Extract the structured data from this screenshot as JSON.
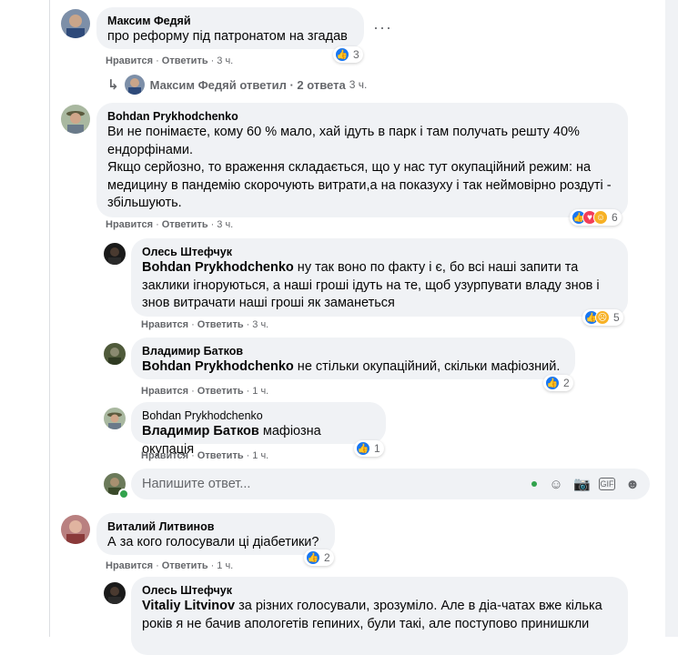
{
  "comments": [
    {
      "author": "Максим Федяй",
      "text": "про реформу під патронатом на згадав",
      "actions": {
        "like": "Нравится",
        "reply": "Ответить",
        "time": "3 ч."
      },
      "reactions": {
        "count": "3"
      },
      "replies_link": {
        "author": "Максим Федяй",
        "label": "ответил · 2 ответа",
        "time": "3 ч."
      }
    },
    {
      "author": "Bohdan Prykhodchenko",
      "text": "Ви не понімаєте, кому 60 % мало, хай ідуть в парк і там получать решту 40% ендорфінами.\nЯкщо серйозно, то враження складається, що у нас тут окупаційний режим: на медицину в пандемію скорочують витрати,а на показуху і так неймовірно роздуті - збільшують.",
      "actions": {
        "like": "Нравится",
        "reply": "Ответить",
        "time": "3 ч."
      },
      "reactions": {
        "count": "6"
      },
      "replies": [
        {
          "author": "Олесь Штефчук",
          "mention": "Bohdan Prykhodchenko",
          "text": " ну так воно по факту і є, бо всі наші запити та заклики ігноруються, а наші гроші ідуть на те, щоб узурпувати владу знов і знов витрачати наші гроші як заманеться",
          "actions": {
            "like": "Нравится",
            "reply": "Ответить",
            "time": "3 ч."
          },
          "reactions": {
            "count": "5"
          }
        },
        {
          "author": "Владимир Батков",
          "mention": "Bohdan Prykhodchenko",
          "text": " не стільки окупаційний, скільки мафіозний.",
          "actions": {
            "like": "Нравится",
            "reply": "Ответить",
            "time": "1 ч."
          },
          "reactions": {
            "count": "2"
          }
        },
        {
          "author": "Bohdan Prykhodchenko",
          "mention": "Владимир Батков",
          "text": " мафіозна окупація",
          "actions": {
            "like": "Нравится",
            "reply": "Ответить",
            "time": "1 ч."
          },
          "reactions": {
            "count": "1"
          }
        }
      ],
      "reply_input": {
        "placeholder": "Напишите ответ..."
      }
    },
    {
      "author": "Виталий Литвинов",
      "text": "А за кого голосували ці діабетики?",
      "actions": {
        "like": "Нравится",
        "reply": "Ответить",
        "time": "1 ч."
      },
      "reactions": {
        "count": "2"
      },
      "replies": [
        {
          "author": "Олесь Штефчук",
          "mention": "Vitaliy Litvinov",
          "text": " за різних голосували, зрозуміло. Але в діа-чатах вже кілька років я не бачив апологетів гепиних, були такі, але поступово принишкли"
        }
      ]
    }
  ],
  "colors": {
    "like": "#1877f2",
    "bubble": "#f0f2f5",
    "meta": "#65676b"
  }
}
